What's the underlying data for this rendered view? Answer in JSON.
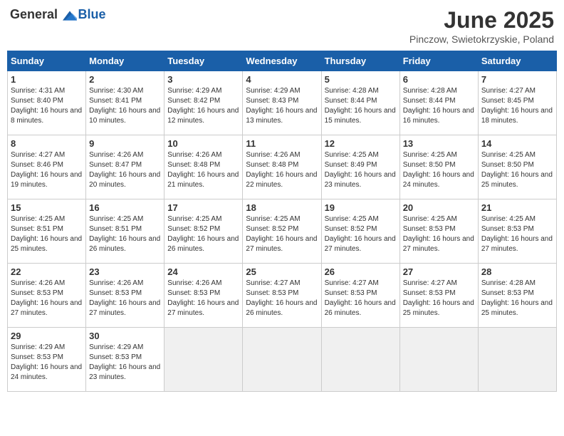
{
  "header": {
    "logo_general": "General",
    "logo_blue": "Blue",
    "month": "June 2025",
    "location": "Pinczow, Swietokrzyskie, Poland"
  },
  "days_of_week": [
    "Sunday",
    "Monday",
    "Tuesday",
    "Wednesday",
    "Thursday",
    "Friday",
    "Saturday"
  ],
  "weeks": [
    [
      {
        "day": "1",
        "sunrise": "4:31 AM",
        "sunset": "8:40 PM",
        "daylight": "16 hours and 8 minutes."
      },
      {
        "day": "2",
        "sunrise": "4:30 AM",
        "sunset": "8:41 PM",
        "daylight": "16 hours and 10 minutes."
      },
      {
        "day": "3",
        "sunrise": "4:29 AM",
        "sunset": "8:42 PM",
        "daylight": "16 hours and 12 minutes."
      },
      {
        "day": "4",
        "sunrise": "4:29 AM",
        "sunset": "8:43 PM",
        "daylight": "16 hours and 13 minutes."
      },
      {
        "day": "5",
        "sunrise": "4:28 AM",
        "sunset": "8:44 PM",
        "daylight": "16 hours and 15 minutes."
      },
      {
        "day": "6",
        "sunrise": "4:28 AM",
        "sunset": "8:44 PM",
        "daylight": "16 hours and 16 minutes."
      },
      {
        "day": "7",
        "sunrise": "4:27 AM",
        "sunset": "8:45 PM",
        "daylight": "16 hours and 18 minutes."
      }
    ],
    [
      {
        "day": "8",
        "sunrise": "4:27 AM",
        "sunset": "8:46 PM",
        "daylight": "16 hours and 19 minutes."
      },
      {
        "day": "9",
        "sunrise": "4:26 AM",
        "sunset": "8:47 PM",
        "daylight": "16 hours and 20 minutes."
      },
      {
        "day": "10",
        "sunrise": "4:26 AM",
        "sunset": "8:48 PM",
        "daylight": "16 hours and 21 minutes."
      },
      {
        "day": "11",
        "sunrise": "4:26 AM",
        "sunset": "8:48 PM",
        "daylight": "16 hours and 22 minutes."
      },
      {
        "day": "12",
        "sunrise": "4:25 AM",
        "sunset": "8:49 PM",
        "daylight": "16 hours and 23 minutes."
      },
      {
        "day": "13",
        "sunrise": "4:25 AM",
        "sunset": "8:50 PM",
        "daylight": "16 hours and 24 minutes."
      },
      {
        "day": "14",
        "sunrise": "4:25 AM",
        "sunset": "8:50 PM",
        "daylight": "16 hours and 25 minutes."
      }
    ],
    [
      {
        "day": "15",
        "sunrise": "4:25 AM",
        "sunset": "8:51 PM",
        "daylight": "16 hours and 25 minutes."
      },
      {
        "day": "16",
        "sunrise": "4:25 AM",
        "sunset": "8:51 PM",
        "daylight": "16 hours and 26 minutes."
      },
      {
        "day": "17",
        "sunrise": "4:25 AM",
        "sunset": "8:52 PM",
        "daylight": "16 hours and 26 minutes."
      },
      {
        "day": "18",
        "sunrise": "4:25 AM",
        "sunset": "8:52 PM",
        "daylight": "16 hours and 27 minutes."
      },
      {
        "day": "19",
        "sunrise": "4:25 AM",
        "sunset": "8:52 PM",
        "daylight": "16 hours and 27 minutes."
      },
      {
        "day": "20",
        "sunrise": "4:25 AM",
        "sunset": "8:53 PM",
        "daylight": "16 hours and 27 minutes."
      },
      {
        "day": "21",
        "sunrise": "4:25 AM",
        "sunset": "8:53 PM",
        "daylight": "16 hours and 27 minutes."
      }
    ],
    [
      {
        "day": "22",
        "sunrise": "4:26 AM",
        "sunset": "8:53 PM",
        "daylight": "16 hours and 27 minutes."
      },
      {
        "day": "23",
        "sunrise": "4:26 AM",
        "sunset": "8:53 PM",
        "daylight": "16 hours and 27 minutes."
      },
      {
        "day": "24",
        "sunrise": "4:26 AM",
        "sunset": "8:53 PM",
        "daylight": "16 hours and 27 minutes."
      },
      {
        "day": "25",
        "sunrise": "4:27 AM",
        "sunset": "8:53 PM",
        "daylight": "16 hours and 26 minutes."
      },
      {
        "day": "26",
        "sunrise": "4:27 AM",
        "sunset": "8:53 PM",
        "daylight": "16 hours and 26 minutes."
      },
      {
        "day": "27",
        "sunrise": "4:27 AM",
        "sunset": "8:53 PM",
        "daylight": "16 hours and 25 minutes."
      },
      {
        "day": "28",
        "sunrise": "4:28 AM",
        "sunset": "8:53 PM",
        "daylight": "16 hours and 25 minutes."
      }
    ],
    [
      {
        "day": "29",
        "sunrise": "4:29 AM",
        "sunset": "8:53 PM",
        "daylight": "16 hours and 24 minutes."
      },
      {
        "day": "30",
        "sunrise": "4:29 AM",
        "sunset": "8:53 PM",
        "daylight": "16 hours and 23 minutes."
      },
      null,
      null,
      null,
      null,
      null
    ]
  ]
}
